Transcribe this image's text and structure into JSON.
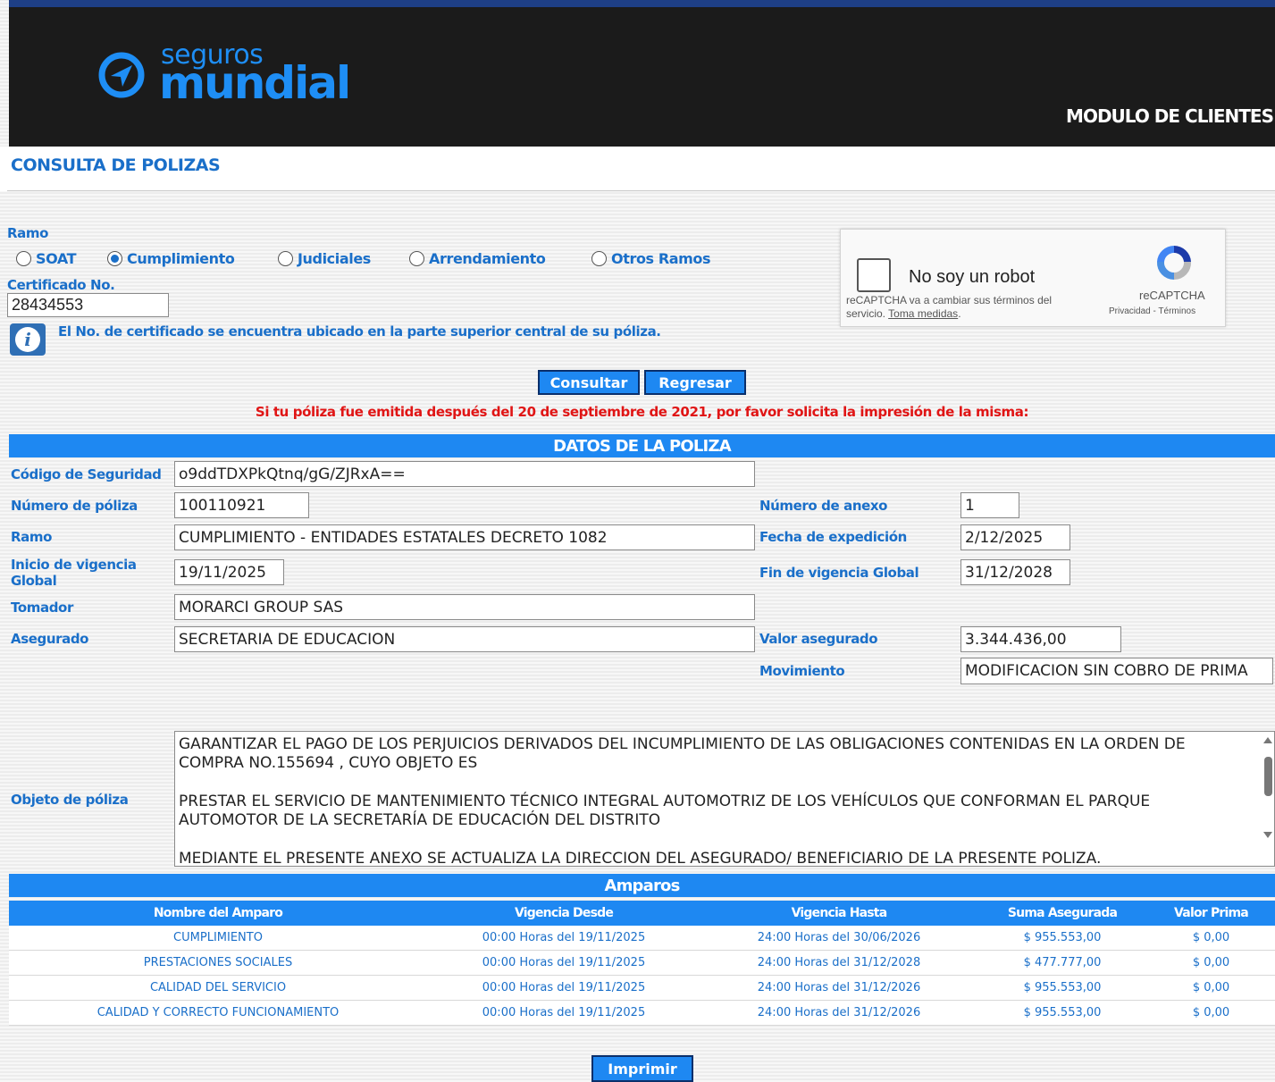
{
  "header": {
    "logo_small": "seguros",
    "logo_big": "mundial",
    "module_title": "MODULO DE CLIENTES"
  },
  "page_title": "CONSULTA DE POLIZAS",
  "form": {
    "ramo_label": "Ramo",
    "ramo_options": [
      "SOAT",
      "Cumplimiento",
      "Judiciales",
      "Arrendamiento",
      "Otros Ramos"
    ],
    "ramo_selected": "Cumplimiento",
    "certificado_label": "Certificado No.",
    "certificado_value": "28434553",
    "info_text": "El No. de certificado se encuentra ubicado en la parte superior central de su póliza."
  },
  "captcha": {
    "label": "No soy un robot",
    "note": "reCAPTCHA va a cambiar sus términos del servicio.",
    "note_link": "Toma medidas",
    "brand": "reCAPTCHA",
    "privacy": "Privacidad - Términos"
  },
  "buttons": {
    "consultar": "Consultar",
    "regresar": "Regresar",
    "imprimir": "Imprimir"
  },
  "notice": "Si tu póliza fue emitida después del 20 de septiembre de 2021, por favor solicita la impresión de la misma:",
  "datos": {
    "title": "DATOS DE LA POLIZA",
    "codigo_label": "Código de Seguridad",
    "codigo_value": "o9ddTDXPkQtnq/gG/ZJRxA==",
    "numero_poliza_label": "Número de póliza",
    "numero_poliza_value": "100110921",
    "numero_anexo_label": "Número de anexo",
    "numero_anexo_value": "1",
    "ramo_label": "Ramo",
    "ramo_value": "CUMPLIMIENTO - ENTIDADES ESTATALES DECRETO 1082",
    "fecha_expedicion_label": "Fecha de expedición",
    "fecha_expedicion_value": "2/12/2025",
    "inicio_vigencia_label_1": "Inicio de vigencia",
    "inicio_vigencia_label_2": "Global",
    "inicio_vigencia_value": "19/11/2025",
    "fin_vigencia_label": "Fin de vigencia Global",
    "fin_vigencia_value": "31/12/2028",
    "tomador_label": "Tomador",
    "tomador_value": "MORARCI GROUP SAS",
    "asegurado_label": "Asegurado",
    "asegurado_value": "SECRETARIA DE EDUCACION",
    "valor_asegurado_label": "Valor asegurado",
    "valor_asegurado_value": "3.344.436,00",
    "movimiento_label": "Movimiento",
    "movimiento_value": "MODIFICACION SIN COBRO DE PRIMA",
    "objeto_label": "Objeto de póliza",
    "objeto_p1": "GARANTIZAR EL PAGO DE LOS PERJUICIOS DERIVADOS DEL INCUMPLIMIENTO DE LAS OBLIGACIONES CONTENIDAS EN LA ORDEN DE COMPRA NO.155694 , CUYO OBJETO ES",
    "objeto_p2": "PRESTAR EL SERVICIO DE MANTENIMIENTO TÉCNICO INTEGRAL AUTOMOTRIZ DE LOS VEHÍCULOS QUE CONFORMAN EL PARQUE AUTOMOTOR DE LA SECRETARÍA DE EDUCACIÓN DEL DISTRITO",
    "objeto_p3": "MEDIANTE EL PRESENTE ANEXO SE ACTUALIZA LA DIRECCION DEL ASEGURADO/ BENEFICIARIO DE LA PRESENTE POLIZA."
  },
  "amparos": {
    "title": "Amparos",
    "columns": [
      "Nombre del Amparo",
      "Vigencia Desde",
      "Vigencia Hasta",
      "Suma Asegurada",
      "Valor Prima"
    ],
    "rows": [
      [
        "CUMPLIMIENTO",
        "00:00 Horas del 19/11/2025",
        "24:00 Horas del 30/06/2026",
        "$ 955.553,00",
        "$ 0,00"
      ],
      [
        "PRESTACIONES SOCIALES",
        "00:00 Horas del 19/11/2025",
        "24:00 Horas del 31/12/2028",
        "$ 477.777,00",
        "$ 0,00"
      ],
      [
        "CALIDAD DEL SERVICIO",
        "00:00 Horas del 19/11/2025",
        "24:00 Horas del 31/12/2026",
        "$ 955.553,00",
        "$ 0,00"
      ],
      [
        "CALIDAD Y CORRECTO FUNCIONAMIENTO",
        "00:00 Horas del 19/11/2025",
        "24:00 Horas del 31/12/2026",
        "$ 955.553,00",
        "$ 0,00"
      ]
    ]
  },
  "colors": {
    "header_bg": "#1b1b1b",
    "accent_blue": "#1e88f2",
    "label_blue": "#1a6fc9",
    "alert_red": "#e01515"
  }
}
